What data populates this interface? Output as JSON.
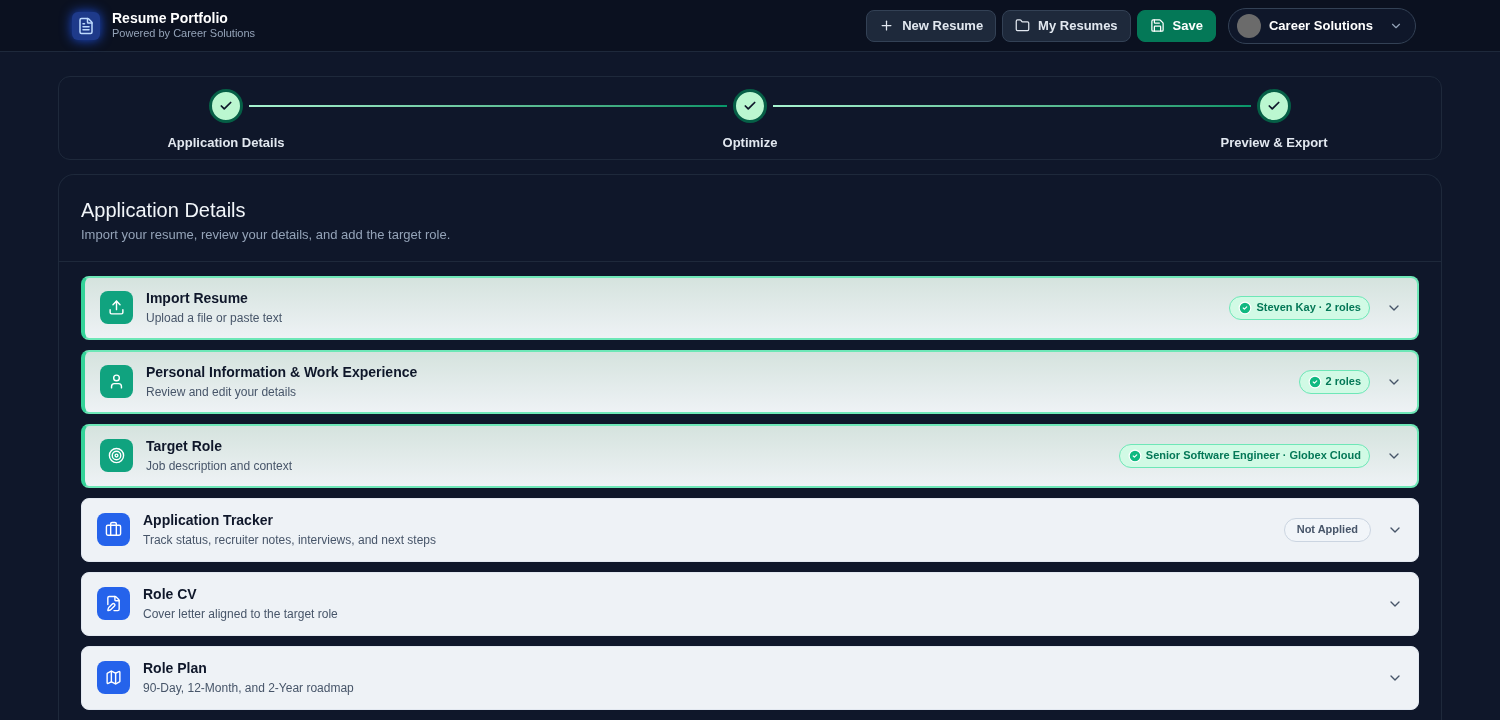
{
  "header": {
    "title": "Resume Portfolio",
    "subtitle": "Powered by Career Solutions",
    "buttons": [
      {
        "label": "New Resume",
        "kind": "outline"
      },
      {
        "label": "My Resumes",
        "kind": "outline"
      },
      {
        "label": "Save",
        "kind": "primary"
      }
    ],
    "account": "Career Solutions"
  },
  "steps": [
    {
      "label": "Application Details",
      "done": true
    },
    {
      "label": "Optimize",
      "done": true
    },
    {
      "label": "Preview & Export",
      "done": true
    }
  ],
  "panel": {
    "title": "Application Details",
    "subtitle": "Import your resume, review your details, and add the target role.",
    "sections": [
      {
        "title": "Import Resume",
        "subtitle": "Upload a file or paste text",
        "complete": true,
        "badge": {
          "label": "Steven Kay · 2 roles",
          "kind": "success"
        }
      },
      {
        "title": "Personal Information & Work Experience",
        "subtitle": "Review and edit your details",
        "complete": true,
        "badge": {
          "label": "2 roles",
          "kind": "success"
        }
      },
      {
        "title": "Target Role",
        "subtitle": "Job description and context",
        "complete": true,
        "badge": {
          "label": "Senior Software Engineer · Globex Cloud",
          "kind": "success"
        }
      },
      {
        "title": "Application Tracker",
        "subtitle": "Track status, recruiter notes, interviews, and next steps",
        "complete": false,
        "badge": {
          "label": "Not Applied",
          "kind": "neutral"
        }
      },
      {
        "title": "Role CV",
        "subtitle": "Cover letter aligned to the target role",
        "complete": false
      },
      {
        "title": "Role Plan",
        "subtitle": "90-Day, 12-Month, and 2-Year roadmap",
        "complete": false
      }
    ]
  }
}
